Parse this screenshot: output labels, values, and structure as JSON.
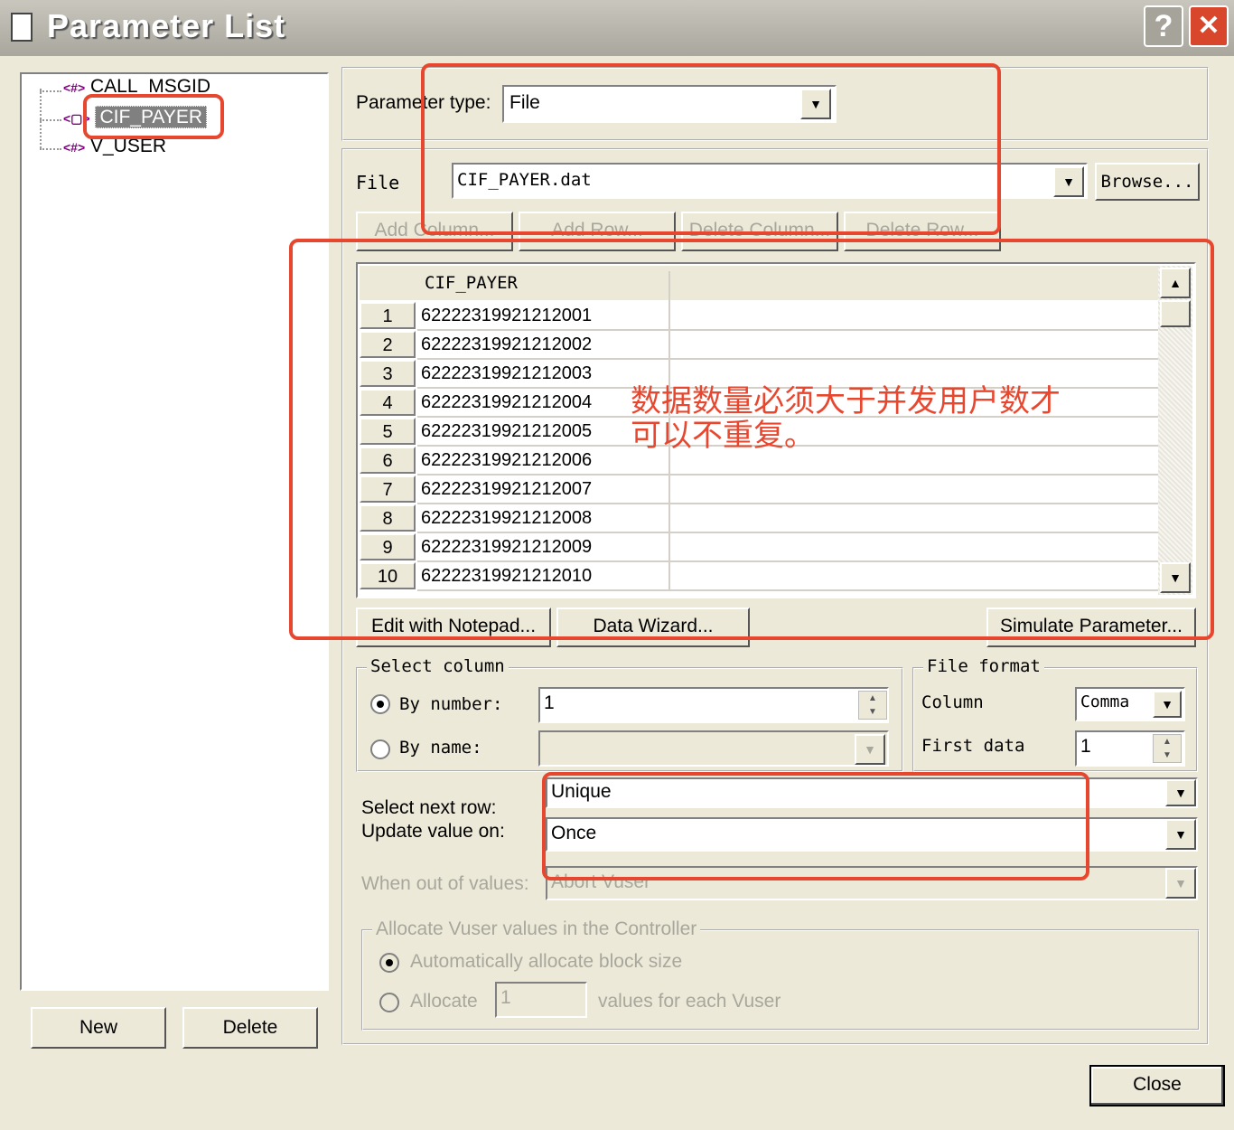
{
  "window": {
    "title": "Parameter List",
    "help_label": "?",
    "close_label": "✕",
    "icon": "document-icon"
  },
  "tree": {
    "items": [
      {
        "tag": "<#>",
        "name": "CALL_MSGID",
        "icon": "number-param-icon"
      },
      {
        "tag": "<▢>",
        "name": "CIF_PAYER",
        "icon": "file-param-icon",
        "selected": true
      },
      {
        "tag": "<#>",
        "name": "V_USER",
        "icon": "number-param-icon"
      }
    ]
  },
  "left_buttons": {
    "new_label": "New",
    "delete_label": "Delete"
  },
  "parameter_type": {
    "label": "Parameter type:",
    "value": "File"
  },
  "file": {
    "label": "File",
    "value": "CIF_PAYER.dat",
    "browse_label": "Browse..."
  },
  "grid_toolbar": {
    "add_column": "Add Column...",
    "add_row": "Add Row...",
    "delete_column": "Delete Column...",
    "delete_row": "Delete Row..."
  },
  "grid": {
    "column_header": "CIF_PAYER",
    "rows": [
      {
        "num": "1",
        "value": "62222319921212001"
      },
      {
        "num": "2",
        "value": "62222319921212002"
      },
      {
        "num": "3",
        "value": "62222319921212003"
      },
      {
        "num": "4",
        "value": "62222319921212004"
      },
      {
        "num": "5",
        "value": "62222319921212005"
      },
      {
        "num": "6",
        "value": "62222319921212006"
      },
      {
        "num": "7",
        "value": "62222319921212007"
      },
      {
        "num": "8",
        "value": "62222319921212008"
      },
      {
        "num": "9",
        "value": "62222319921212009"
      },
      {
        "num": "10",
        "value": "62222319921212010"
      }
    ]
  },
  "grid_actions": {
    "edit_notepad": "Edit with Notepad...",
    "data_wizard": "Data Wizard...",
    "simulate": "Simulate Parameter..."
  },
  "select_column": {
    "title": "Select column",
    "by_number_label": "By number:",
    "by_number_value": "1",
    "by_name_label": "By name:",
    "by_name_value": ""
  },
  "file_format": {
    "title": "File format",
    "column_label": "Column",
    "column_value": "Comma",
    "first_data_label": "First data",
    "first_data_value": "1"
  },
  "next_row": {
    "select_label": "Select next row:",
    "select_value": "Unique",
    "update_label": "Update value on:",
    "update_value": "Once",
    "out_label": "When out of values:",
    "out_value": "Abort Vuser"
  },
  "allocate": {
    "title": "Allocate Vuser values in the Controller",
    "auto_label": "Automatically allocate block size",
    "allocate_label": "Allocate",
    "allocate_value": "1",
    "suffix_label": "values for each Vuser"
  },
  "close_button": "Close",
  "annotation": {
    "line1": "数据数量必须大于并发用户数才",
    "line2": "可以不重复。",
    "color": "#e8472f"
  }
}
